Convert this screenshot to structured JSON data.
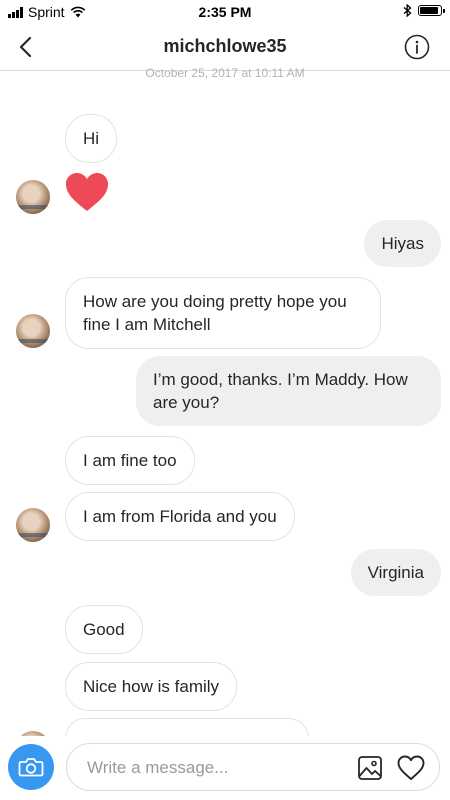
{
  "status_bar": {
    "carrier": "Sprint",
    "time": "2:35 PM",
    "battery_level": 0.92
  },
  "header": {
    "title": "michchlowe35",
    "back_icon": "chevron-left-icon",
    "info_icon": "info-icon"
  },
  "thread": {
    "timestamp": "October 25, 2017 at 10:11 AM",
    "messages": [
      {
        "from": "them",
        "text": "Hi"
      },
      {
        "from": "them",
        "type": "like",
        "icon": "heart-icon",
        "color": "#ed4956"
      },
      {
        "from": "me",
        "text": "Hiyas"
      },
      {
        "from": "them",
        "text": "How are you doing pretty hope you fine I am Mitchell"
      },
      {
        "from": "me",
        "text": "I’m good, thanks. I’m Maddy. How are you?"
      },
      {
        "from": "them",
        "text": "I am fine too"
      },
      {
        "from": "them",
        "text": "I am from Florida and you"
      },
      {
        "from": "me",
        "text": "Virginia"
      },
      {
        "from": "them",
        "text": "Good"
      },
      {
        "from": "them",
        "text": "Nice how is family"
      }
    ]
  },
  "composer": {
    "placeholder": "Write a message...",
    "camera_icon": "camera-icon",
    "gallery_icon": "image-icon",
    "like_icon": "heart-outline-icon",
    "accent": "#3897f0"
  }
}
